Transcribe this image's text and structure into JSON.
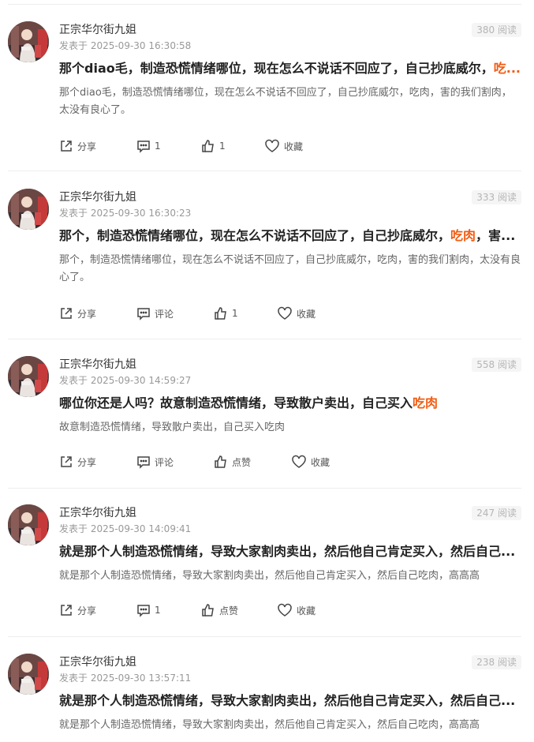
{
  "colors": {
    "highlight": "#f25b12",
    "muted": "#999999",
    "divider": "#eeeeee"
  },
  "icons": {
    "share": "share-icon",
    "comment": "comment-icon",
    "like": "thumbs-up-icon",
    "favorite": "heart-icon"
  },
  "posts": [
    {
      "author": "正宗华尔街九姐",
      "time": "发表于 2025-09-30 16:30:58",
      "reads": "380 阅读",
      "title_pre": "那个diao毛，制造恐慌情绪哪位，现在怎么不说话不回应了，自己抄底威尔，",
      "title_hl": "吃...",
      "title_post": "",
      "body": "那个diao毛，制造恐慌情绪哪位，现在怎么不说话不回应了，自己抄底威尔，吃肉，害的我们割肉，太没有良心了。",
      "share": "分享",
      "comment": "1",
      "like": "1",
      "favorite": "收藏"
    },
    {
      "author": "正宗华尔街九姐",
      "time": "发表于 2025-09-30 16:30:23",
      "reads": "333 阅读",
      "title_pre": "那个，制造恐慌情绪哪位，现在怎么不说话不回应了，自己抄底威尔，",
      "title_hl": "吃肉",
      "title_post": "，害...",
      "body": "那个，制造恐慌情绪哪位，现在怎么不说话不回应了，自己抄底威尔，吃肉，害的我们割肉，太没有良心了。",
      "share": "分享",
      "comment": "评论",
      "like": "1",
      "favorite": "收藏"
    },
    {
      "author": "正宗华尔街九姐",
      "time": "发表于 2025-09-30 14:59:27",
      "reads": "558 阅读",
      "title_pre": "哪位你还是人吗？故意制造恐慌情绪，导致散户卖出，自己买入",
      "title_hl": "吃肉",
      "title_post": "",
      "body": "故意制造恐慌情绪，导致散户卖出，自己买入吃肉",
      "share": "分享",
      "comment": "评论",
      "like": "点赞",
      "favorite": "收藏"
    },
    {
      "author": "正宗华尔街九姐",
      "time": "发表于 2025-09-30 14:09:41",
      "reads": "247 阅读",
      "title_pre": "就是那个人制造恐慌情绪，导致大家割肉卖出，然后他自己肯定买入，然后自己...",
      "title_hl": "",
      "title_post": "",
      "body": "就是那个人制造恐慌情绪，导致大家割肉卖出，然后他自己肯定买入，然后自己吃肉，高高高",
      "share": "分享",
      "comment": "1",
      "like": "点赞",
      "favorite": "收藏"
    },
    {
      "author": "正宗华尔街九姐",
      "time": "发表于 2025-09-30 13:57:11",
      "reads": "238 阅读",
      "title_pre": "就是那个人制造恐慌情绪，导致大家割肉卖出，然后他自己肯定买入，然后自己...",
      "title_hl": "",
      "title_post": "",
      "body": "就是那个人制造恐慌情绪，导致大家割肉卖出，然后他自己肯定买入，然后自己吃肉，高高高",
      "share": "分享",
      "comment": "评论",
      "like": "点赞",
      "favorite": "收藏"
    }
  ]
}
